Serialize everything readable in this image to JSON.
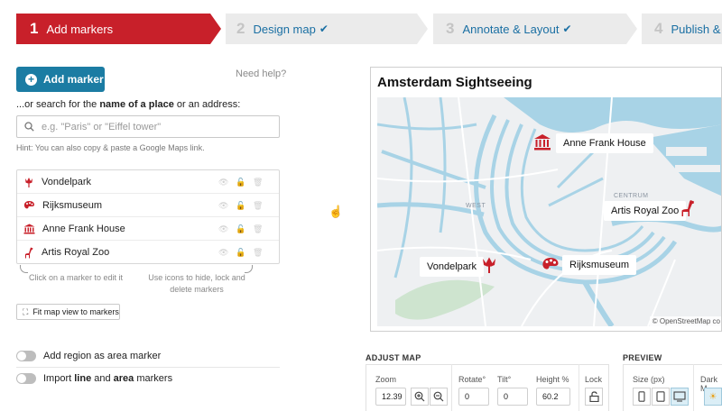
{
  "steps": [
    {
      "num": "1",
      "label": "Add markers"
    },
    {
      "num": "2",
      "label": "Design map"
    },
    {
      "num": "3",
      "label": "Annotate & Layout"
    },
    {
      "num": "4",
      "label": "Publish & E"
    }
  ],
  "step_check": "✔",
  "left": {
    "add_marker": "Add marker",
    "need_help": "Need help?",
    "search_label_pre": "...or search for the ",
    "search_label_bold": "name of a place",
    "search_label_post": " or an address:",
    "search_placeholder": "e.g. \"Paris\" or \"Eiffel tower\"",
    "hint": "Hint: You can also copy & paste a Google Maps link.",
    "markers": [
      {
        "name": "Vondelpark",
        "icon": "tulip-icon"
      },
      {
        "name": "Rijksmuseum",
        "icon": "palette-icon"
      },
      {
        "name": "Anne Frank House",
        "icon": "museum-icon"
      },
      {
        "name": "Artis Royal Zoo",
        "icon": "giraffe-icon"
      }
    ],
    "list_hint_left": "Click on a marker to edit it",
    "list_hint_right": "Use icons to hide, lock and delete markers",
    "fit_map": "Fit map view to markers",
    "toggle_region": "Add region as area marker",
    "toggle_import_pre": "Import ",
    "toggle_import_line": "line",
    "toggle_import_mid": " and ",
    "toggle_import_area": "area",
    "toggle_import_post": " markers"
  },
  "map": {
    "title": "Amsterdam Sightseeing",
    "attribution": "© OpenStreetMap co",
    "place_west": "WEST",
    "place_centrum": "CENTRUM",
    "labels": {
      "anne": "Anne Frank House",
      "zoo": "Artis Royal Zoo",
      "vondel": "Vondelpark",
      "rijks": "Rijksmuseum"
    },
    "colors": {
      "water": "#a8d3e6",
      "land": "#eef0f2",
      "marker": "#c8202a"
    }
  },
  "adjust": {
    "title": "ADJUST MAP",
    "zoom_label": "Zoom",
    "zoom_value": "12.39",
    "rotate_label": "Rotate°",
    "rotate_value": "0",
    "tilt_label": "Tilt°",
    "tilt_value": "0",
    "height_label": "Height %",
    "height_value": "60.2",
    "lock_label": "Lock"
  },
  "preview": {
    "title": "PREVIEW",
    "size_label": "Size (px)",
    "dark_label": "Dark M"
  }
}
